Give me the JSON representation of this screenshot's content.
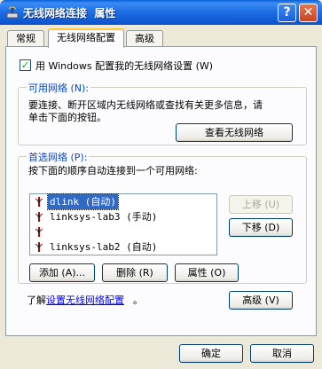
{
  "window": {
    "title": "无线网络连接  属性",
    "help_glyph": "?",
    "close_glyph": "✕"
  },
  "tabs": [
    {
      "label": "常规"
    },
    {
      "label": "无线网络配置"
    },
    {
      "label": "高级"
    }
  ],
  "use_windows_checkbox": {
    "label": "用 Windows 配置我的无线网络设置 (W)",
    "checked": true
  },
  "available_networks": {
    "legend": "可用网络 (N):",
    "description_line1": "要连接、断开区域内无线网络或查找有关更多信息，请",
    "description_line2": "单击下面的按钮。",
    "view_button": "查看无线网络"
  },
  "preferred_networks": {
    "legend": "首选网络 (P):",
    "description": "按下面的顺序自动连接到一个可用网络:",
    "items": [
      {
        "label": "dlink (自动)",
        "selected": true
      },
      {
        "label": "linksys-lab3 (手动)",
        "selected": false
      },
      {
        "label": "",
        "selected": false
      },
      {
        "label": "linksys-lab2 (自动)",
        "selected": false
      }
    ],
    "move_up_button": "上移 (U)",
    "move_down_button": "下移 (D)",
    "add_button": "添加 (A)...",
    "remove_button": "删除 (R)",
    "properties_button": "属性 (O)"
  },
  "learn_more": {
    "prefix": "了解",
    "link": "设置无线网络配置",
    "suffix": "。"
  },
  "advanced_button": "高级 (V)",
  "footer": {
    "ok_button": "确定",
    "cancel_button": "取消"
  },
  "colors": {
    "titlebar": "#0b52cc",
    "group_legend": "#0046d5",
    "selection": "#316ac5",
    "dialog_bg": "#ece9d8"
  }
}
